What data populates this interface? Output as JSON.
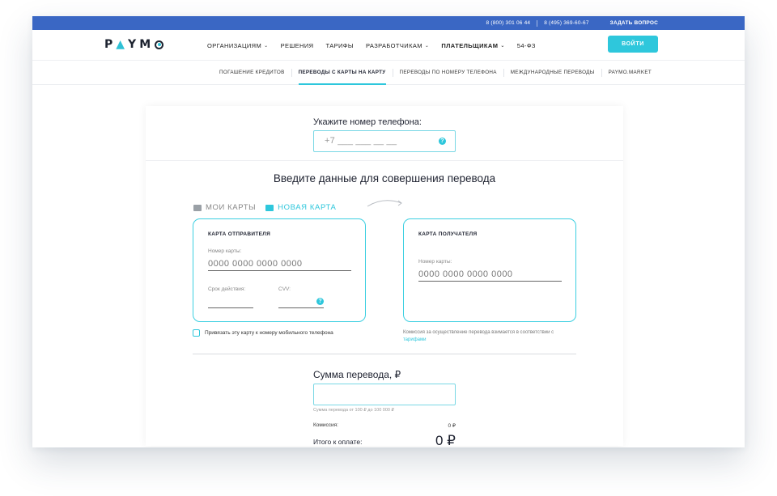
{
  "topbar": {
    "phone1": "8 (800) 301 06 44",
    "phone2": "8 (495) 369-60-67",
    "ask": "ЗАДАТЬ ВОПРОС"
  },
  "header": {
    "logo": "PAYMO",
    "nav": [
      {
        "label": "Организациям",
        "has_chevron": true
      },
      {
        "label": "Решения"
      },
      {
        "label": "Тарифы"
      },
      {
        "label": "Разработчикам",
        "has_chevron": true
      },
      {
        "label": "Плательщикам",
        "has_chevron": true,
        "bold": true
      },
      {
        "label": "54-ФЗ"
      }
    ],
    "login": "Войти"
  },
  "subnav": [
    {
      "label": "Погашение кредитов"
    },
    {
      "label": "Переводы с карты на карту",
      "active": true
    },
    {
      "label": "Переводы по номеру телефона"
    },
    {
      "label": "Международные переводы"
    },
    {
      "label": "Paymo.Market"
    }
  ],
  "form": {
    "phone_label": "Укажите номер телефона:",
    "phone_placeholder": "+7 ___ ___ __ __",
    "section_title": "Введите данные для совершения перевода",
    "tabs": {
      "my_cards": "Мои карты",
      "new_card": "Новая карта"
    },
    "sender": {
      "title": "Карта отправителя",
      "card_label": "Номер карты:",
      "card_placeholder": "0000 0000 0000 0000",
      "expiry_label": "Срок действия:",
      "cvv_label": "CVV:"
    },
    "receiver": {
      "title": "Карта получателя",
      "card_label": "Номер карты:",
      "card_placeholder": "0000 0000 0000 0000"
    },
    "bind_label": "Привязать эту карту к номеру мобильного телефона",
    "commission_note": "Комиссия за осуществление перевода взимается в соответствии с",
    "commission_link": "тарифами",
    "amount_label": "Сумма перевода, ₽",
    "amount_hint": "Сумма перевода от 100 ₽ до 100 000 ₽",
    "fee_label": "Комиссия:",
    "fee_value": "0 ₽",
    "total_label": "Итого к оплате:",
    "total_value": "0 ₽"
  },
  "colors": {
    "accent": "#2ec7dc",
    "topbar": "#3a67c4"
  }
}
